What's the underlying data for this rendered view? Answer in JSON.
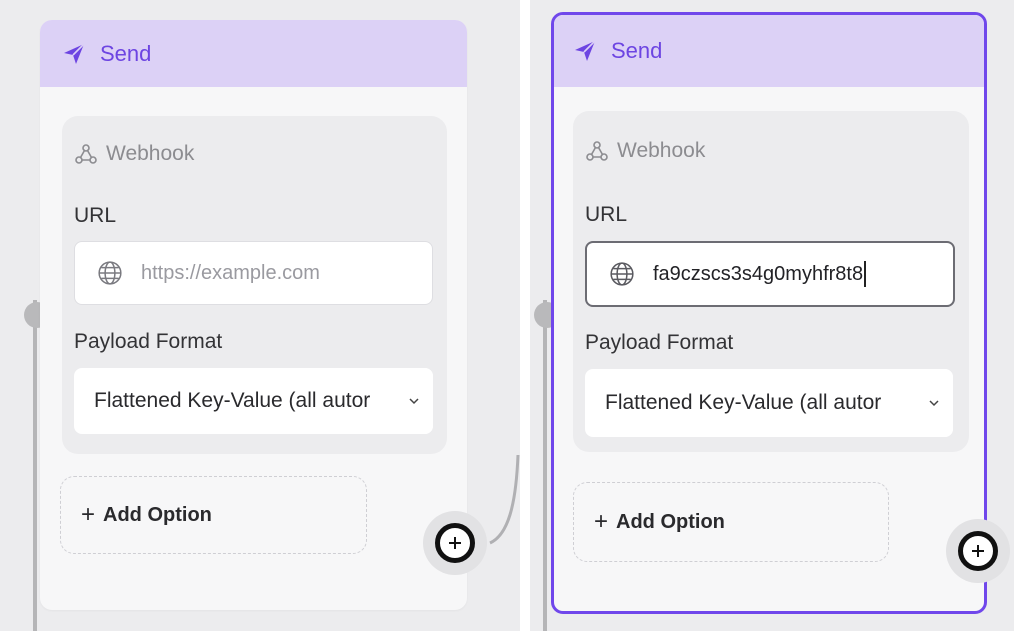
{
  "left_panel": {
    "node": {
      "title": "Send",
      "section": {
        "label": "Webhook",
        "url_label": "URL",
        "url_placeholder": "https://example.com",
        "url_value": "",
        "payload_label": "Payload Format",
        "payload_value": "Flattened Key-Value (all autor"
      },
      "add_option_label": "Add Option"
    },
    "add_button_symbol": "+"
  },
  "right_panel": {
    "node": {
      "title": "Send",
      "selected": true,
      "section": {
        "label": "Webhook",
        "url_label": "URL",
        "url_value": "fa9czscs3s4g0myhfr8t8",
        "payload_label": "Payload Format",
        "payload_value": "Flattened Key-Value (all autor"
      },
      "add_option_label": "Add Option"
    },
    "add_button_symbol": "+"
  },
  "colors": {
    "accent": "#7047eb",
    "header_bg": "#dcd1f6",
    "canvas_bg": "#ececee",
    "node_bg": "#f7f7f8"
  },
  "icons": [
    "send-icon",
    "webhook-icon",
    "globe-icon",
    "chevron-down-icon",
    "plus-icon"
  ]
}
